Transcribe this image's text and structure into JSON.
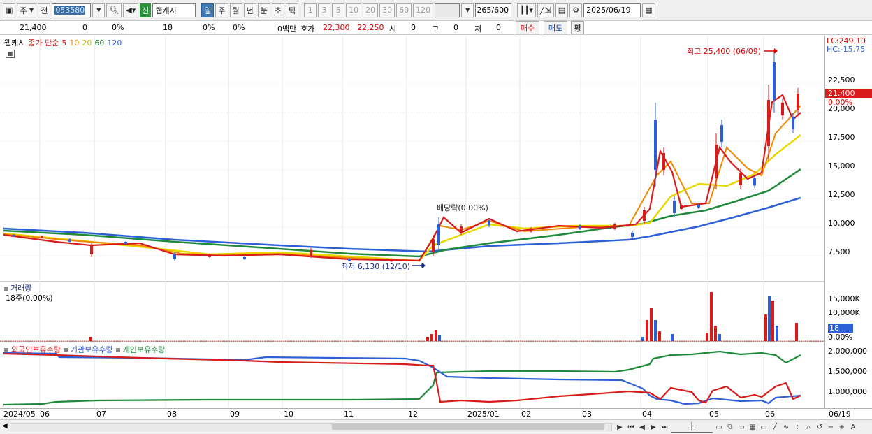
{
  "toolbar": {
    "market": "주",
    "prev": "전",
    "code": "053580",
    "badge": "신",
    "name": "웹케시",
    "periods": [
      "일",
      "주",
      "월",
      "년",
      "분",
      "초",
      "틱"
    ],
    "active_period": "일",
    "intervals": [
      "1",
      "3",
      "5",
      "10",
      "20",
      "30",
      "60",
      "120"
    ],
    "ratio": "265/600",
    "date": "2025/06/19"
  },
  "infobar": {
    "price": "21,400",
    "change": "0",
    "change_pct": "0%",
    "volume": "18",
    "vol_pct1": "0%",
    "vol_pct2": "0%",
    "amount": "0백만",
    "hoga_label": "호가",
    "ask": "22,300",
    "bid": "22,250",
    "si_label": "시",
    "si_val": "0",
    "go_label": "고",
    "go_val": "0",
    "jeo_label": "저",
    "jeo_val": "0",
    "buy": "매수",
    "sell": "매도",
    "pyeong": "평"
  },
  "price_pane": {
    "name": "웹케시",
    "legend_title": "종가 단순",
    "ma_periods": [
      "5",
      "10",
      "20",
      "60",
      "120"
    ],
    "ma_colors": [
      "#d81b1b",
      "#ef8a00",
      "#e8d800",
      "#1f8a3a",
      "#2d5fd6"
    ],
    "high_annot": "최고 25,400 (06/09)",
    "low_annot": "최저 6,130 (12/10)",
    "div_annot": "배당락(0.00%)",
    "lc": "LC:249.10",
    "hc": "HC:-15.75",
    "axis_labels": [
      "22,500",
      "20,000",
      "17,500",
      "15,000",
      "12,500",
      "10,000",
      "7,500"
    ],
    "current_price": "21,400",
    "current_pct": "0.00%"
  },
  "volume_pane": {
    "title": "거래량",
    "sub": "18주(0.00%)",
    "axis_labels": [
      "15,000K",
      "10,000K"
    ],
    "current": "18",
    "current_pct": "0.00%"
  },
  "holding_pane": {
    "legend": [
      "외국인보유수량",
      "기관보유수량",
      "개인보유수량"
    ],
    "legend_colors": [
      "#d81b1b",
      "#2d5fd6",
      "#1f8a3a"
    ],
    "axis_labels": [
      "2,000,000",
      "1,500,000",
      "1,000,000"
    ]
  },
  "xaxis": {
    "labels": [
      "2024/05",
      "06",
      "07",
      "08",
      "09",
      "10",
      "11",
      "12",
      "2025/01",
      "02",
      "03",
      "04",
      "05",
      "06"
    ],
    "right_label": "06/19"
  }
}
